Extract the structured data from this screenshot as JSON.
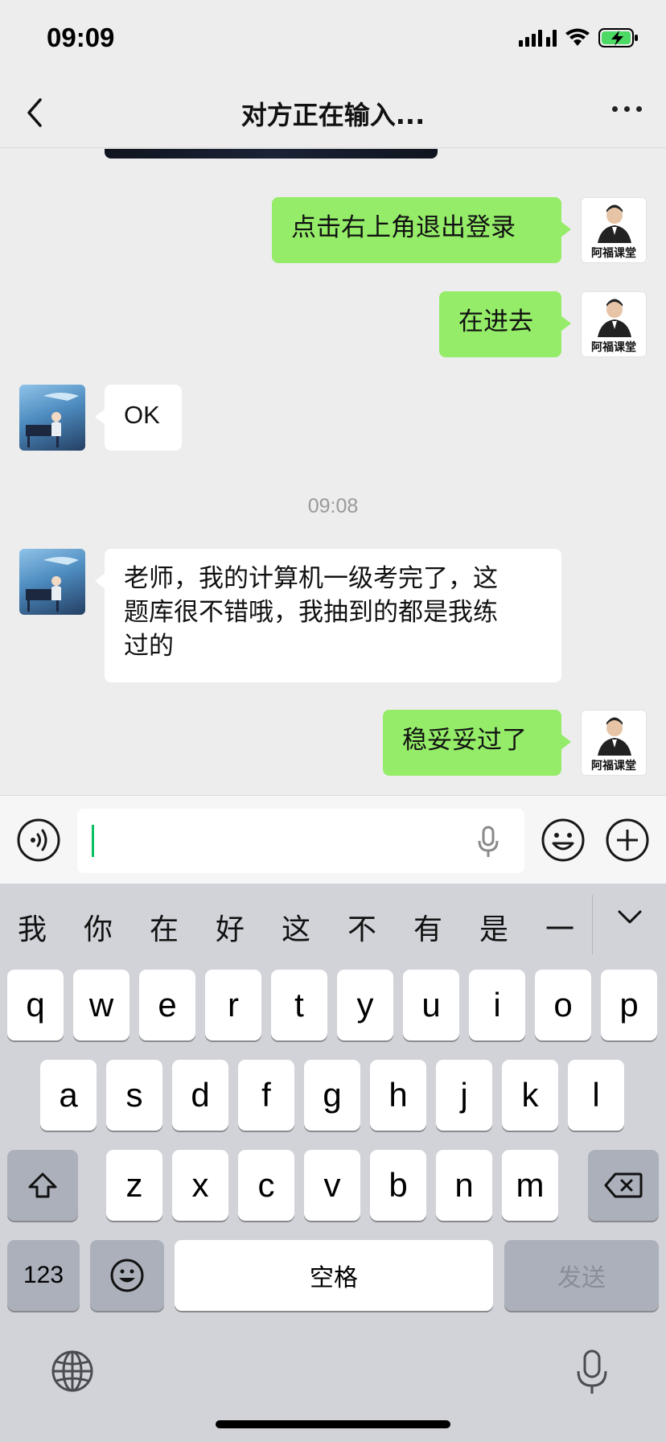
{
  "status_bar": {
    "time": "09:09"
  },
  "nav": {
    "title": "对方正在输入..."
  },
  "messages": [
    {
      "side": "me",
      "text": "点击右上角退出登录"
    },
    {
      "side": "me",
      "text": "在进去"
    },
    {
      "side": "other",
      "text": "OK"
    },
    {
      "side": "other",
      "text_lines": [
        "老师，我的计算机一级考完了，这",
        "题库很不错哦，我抽到的都是我练",
        "过的"
      ]
    },
    {
      "side": "me",
      "text": "稳妥妥过了"
    }
  ],
  "timestamp": "09:08",
  "teacher_avatar": {
    "caption": "阿福课堂"
  },
  "input": {
    "value": ""
  },
  "keyboard": {
    "candidates": [
      "我",
      "你",
      "在",
      "好",
      "这",
      "不",
      "有",
      "是",
      "一"
    ],
    "row1": [
      "q",
      "w",
      "e",
      "r",
      "t",
      "y",
      "u",
      "i",
      "o",
      "p"
    ],
    "row2": [
      "a",
      "s",
      "d",
      "f",
      "g",
      "h",
      "j",
      "k",
      "l"
    ],
    "row3": [
      "z",
      "x",
      "c",
      "v",
      "b",
      "n",
      "m"
    ],
    "numbers_key": "123",
    "space_label": "空格",
    "send_label": "发送"
  },
  "icons": {
    "back": "chevron-left-icon",
    "more": "more-dots-icon",
    "voice": "voice-mode-icon",
    "emoji": "emoji-icon",
    "plus": "plus-icon",
    "mic": "microphone-icon",
    "globe": "globe-icon",
    "shift": "shift-icon",
    "backspace": "backspace-icon"
  },
  "colors": {
    "my_bubble": "#95ec69",
    "other_bubble": "#ffffff",
    "chat_bg": "#ededed",
    "keyboard_bg": "#d1d3d9"
  }
}
